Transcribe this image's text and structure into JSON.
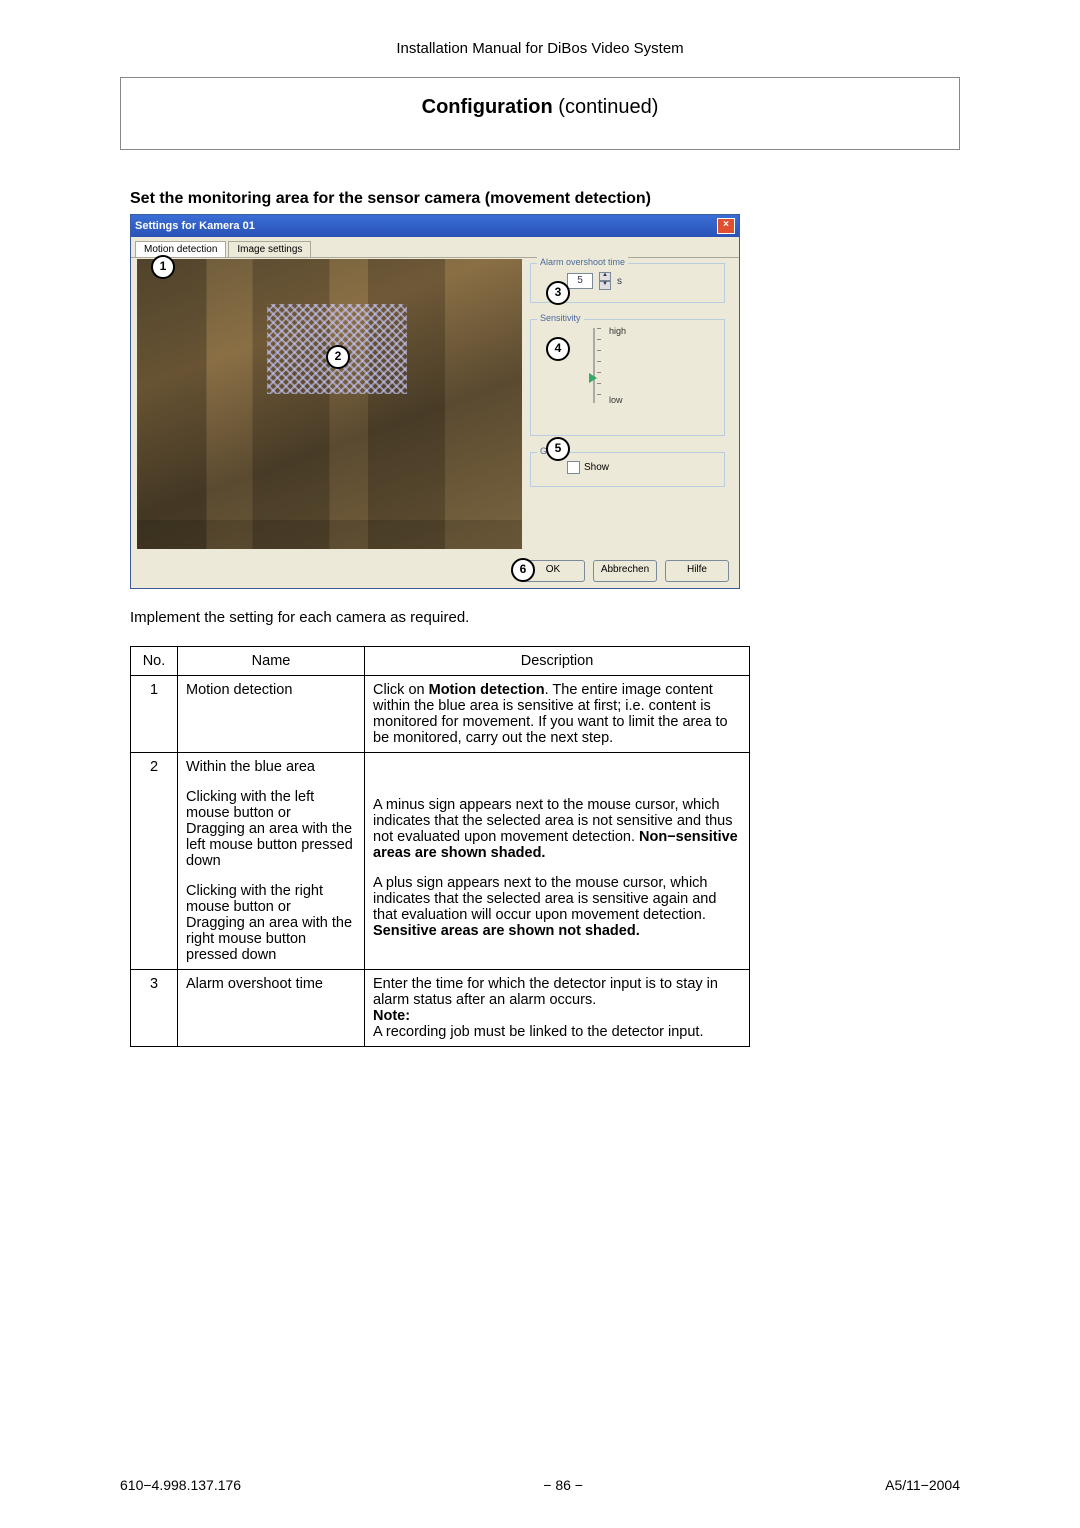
{
  "header": {
    "doc_title": "Installation Manual for DiBos Video System",
    "section_bold": "Configuration",
    "section_rest": " (continued)",
    "subheading": "Set the monitoring area for the sensor camera (movement detection)",
    "instruction": "Implement the setting for each camera as required."
  },
  "screenshot": {
    "window_title": "Settings for Kamera 01",
    "tabs": {
      "motion": "Motion detection",
      "image": "Image settings"
    },
    "overshoot": {
      "legend": "Alarm overshoot time",
      "value": "5",
      "unit": "s"
    },
    "sensitivity": {
      "legend": "Sensitivity",
      "high": "high",
      "low": "low"
    },
    "grid": {
      "legend": "Grid",
      "show_label": "Show"
    },
    "buttons": {
      "ok": "OK",
      "cancel": "Abbrechen",
      "help": "Hilfe"
    },
    "callouts": {
      "c1": "1",
      "c2": "2",
      "c3": "3",
      "c4": "4",
      "c5": "5",
      "c6": "6"
    }
  },
  "table": {
    "headers": {
      "no": "No.",
      "name": "Name",
      "desc": "Description"
    },
    "row1": {
      "no": "1",
      "name": "Motion detection",
      "desc_pre": "Click on ",
      "desc_bold": "Motion detection",
      "desc_post": ". The entire image content within the blue area is sensitive at first; i.e. content is monitored for movement. If you want to limit the area to be monitored, carry out the next step."
    },
    "row2": {
      "no": "2",
      "name_p1": "Within the blue area",
      "name_p2": "Clicking with the left mouse button or",
      "name_p3": "Dragging an area with the left mouse button pressed down",
      "name_p4": "Clicking with the right mouse button or",
      "name_p5": "Dragging an area with the right mouse button pressed down",
      "desc_p1_pre": "A minus sign appears next to the mouse cursor, which indicates that the selected area is not sensitive and thus not evaluated upon movement detection. ",
      "desc_p1_bold": "Non−sensitive areas are shown shaded.",
      "desc_p2_pre": "A plus sign appears next to the mouse cursor, which indicates that the selected area is sensitive again and that evaluation will occur upon movement detection. ",
      "desc_p2_bold": "Sensitive areas are shown not shaded."
    },
    "row3": {
      "no": "3",
      "name": "Alarm overshoot time",
      "desc_l1": "Enter the time for which the detector input is to stay in alarm status after an alarm occurs.",
      "desc_note_label": "Note:",
      "desc_l2": "A recording job must be linked to the detector input."
    }
  },
  "footer": {
    "left": "610−4.998.137.176",
    "center": "− 86 −",
    "right": "A5/11−2004"
  }
}
